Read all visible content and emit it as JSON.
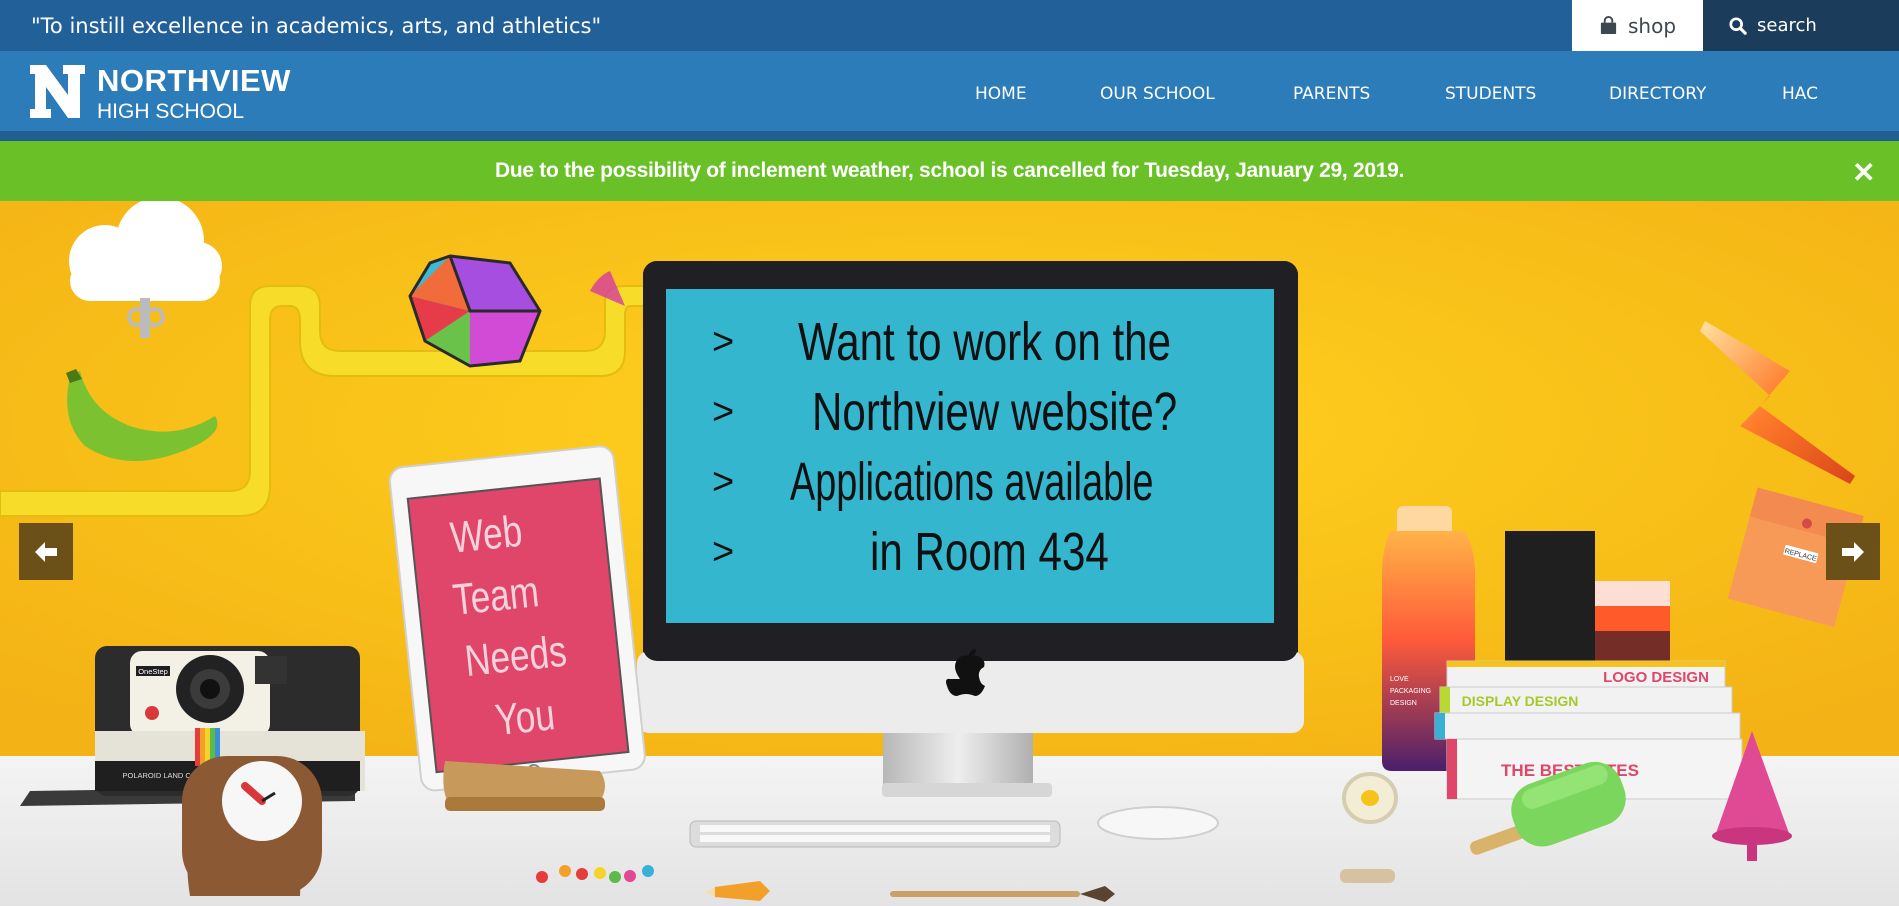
{
  "topbar": {
    "tagline": "\"To instill excellence in academics, arts, and athletics\"",
    "shop_label": "shop",
    "search_label": "search"
  },
  "header": {
    "school_name": "NORTHVIEW",
    "school_sub": "HIGH SCHOOL",
    "logo_letter": "N"
  },
  "nav": [
    {
      "label": "HOME"
    },
    {
      "label": "OUR SCHOOL"
    },
    {
      "label": "PARENTS"
    },
    {
      "label": "STUDENTS"
    },
    {
      "label": "DIRECTORY"
    },
    {
      "label": "HAC"
    }
  ],
  "alert": {
    "message": "Due to the possibility of inclement weather, school is cancelled for Tuesday, January 29, 2019.",
    "close_icon": "close-icon"
  },
  "slide": {
    "monitor_lines": [
      "Want to work on the",
      "Northview website?",
      "Applications available",
      "in Room 434"
    ],
    "monitor_bullet": ">",
    "tablet_lines": [
      "Web",
      "Team",
      "Needs",
      "You"
    ],
    "books": [
      "LOGO DESIGN",
      "DISPLAY DESIGN",
      "THE BEST SITES"
    ],
    "bottle_text": [
      "LOVE",
      "PACKAGING",
      "DESIGN"
    ],
    "camera_brand": "OneStep",
    "camera_label": "POLAROID LAND CAMERA",
    "note_text": "REPLACE",
    "prev_icon": "arrow-left-icon",
    "next_icon": "arrow-right-icon"
  },
  "colors": {
    "topbar": "#22609a",
    "navbar": "#2b7cb8",
    "alert": "#6ac027",
    "hero_bg": "#f6c21c",
    "screen": "#33b6ce",
    "tablet": "#e0466a"
  }
}
